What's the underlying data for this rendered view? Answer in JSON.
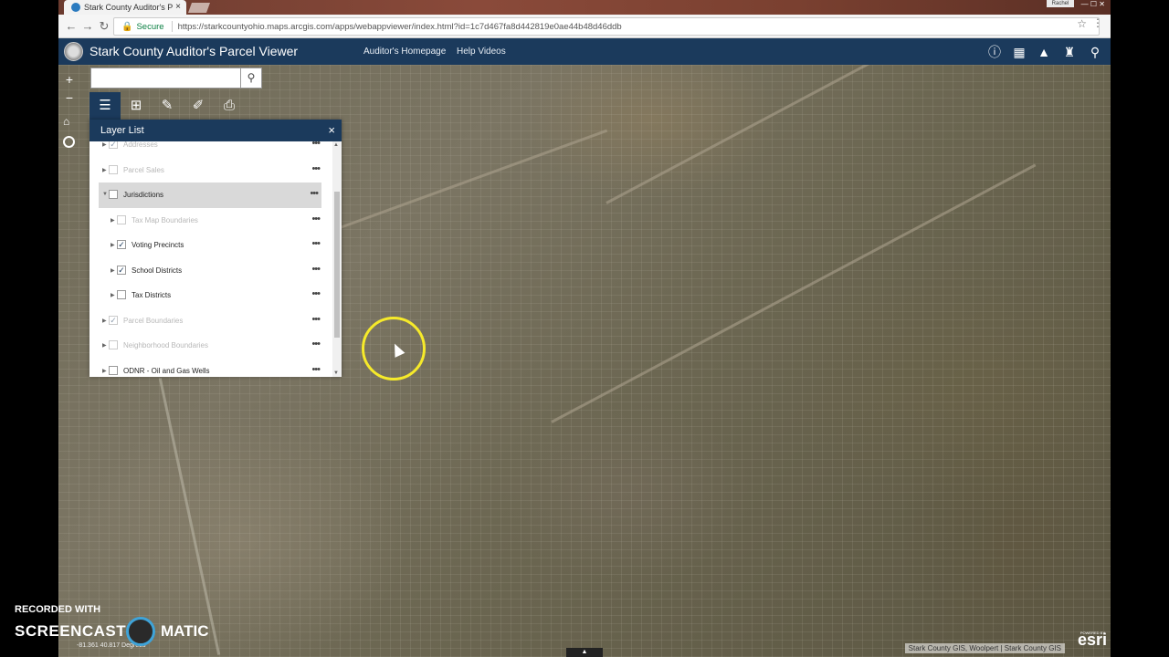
{
  "browser": {
    "tab_title": "Stark County Auditor's P",
    "tab_close": "×",
    "user_badge": "Rachel",
    "secure_label": "Secure",
    "url": "https://starkcountyohio.maps.arcgis.com/apps/webappviewer/index.html?id=1c7d467fa8d442819e0ae44b48d46ddb"
  },
  "header": {
    "title": "Stark County Auditor's Parcel Viewer",
    "links": [
      "Auditor's Homepage",
      "Help Videos"
    ],
    "icons": [
      "info-icon",
      "grid-icon",
      "graduation-cap-icon",
      "bookmark-icon",
      "search-people-icon"
    ]
  },
  "map_widgets": {
    "zoom_in": "+",
    "zoom_out": "−",
    "search_placeholder": ""
  },
  "toolbar": {
    "tools": [
      "layers-icon",
      "basemap-icon",
      "measure-icon",
      "draw-icon",
      "print-icon"
    ]
  },
  "layer_list": {
    "title": "Layer List",
    "close": "×",
    "more": "•••",
    "layers": [
      {
        "label": "Addresses",
        "checked": true,
        "faded": true,
        "indent": 0
      },
      {
        "label": "Parcel Sales",
        "checked": false,
        "faded": true,
        "indent": 0
      },
      {
        "label": "Jurisdictions",
        "checked": false,
        "faded": false,
        "indent": 0,
        "highlighted": true
      },
      {
        "label": "Tax Map Boundaries",
        "checked": false,
        "faded": true,
        "indent": 1
      },
      {
        "label": "Voting Precincts",
        "checked": true,
        "faded": false,
        "indent": 1
      },
      {
        "label": "School Districts",
        "checked": true,
        "faded": false,
        "indent": 1
      },
      {
        "label": "Tax Districts",
        "checked": false,
        "faded": false,
        "indent": 1
      },
      {
        "label": "Parcel Boundaries",
        "checked": true,
        "faded": true,
        "indent": 0
      },
      {
        "label": "Neighborhood Boundaries",
        "checked": false,
        "faded": true,
        "indent": 0
      },
      {
        "label": "ODNR - Oil and Gas Wells",
        "checked": false,
        "faded": false,
        "indent": 0
      }
    ]
  },
  "footer": {
    "coordinates": "-81.361 40.817 Degrees",
    "attribution": "Stark County GIS, Woolpert | Stark County GIS",
    "logo": "esri",
    "powered_by": "POWERED BY"
  },
  "watermark": {
    "line1": "RECORDED WITH",
    "word1": "SCREENCAST",
    "word2": "MATIC"
  },
  "colors": {
    "header_bg": "#1b3a5c",
    "cursor_ring": "#f6ea2a"
  }
}
